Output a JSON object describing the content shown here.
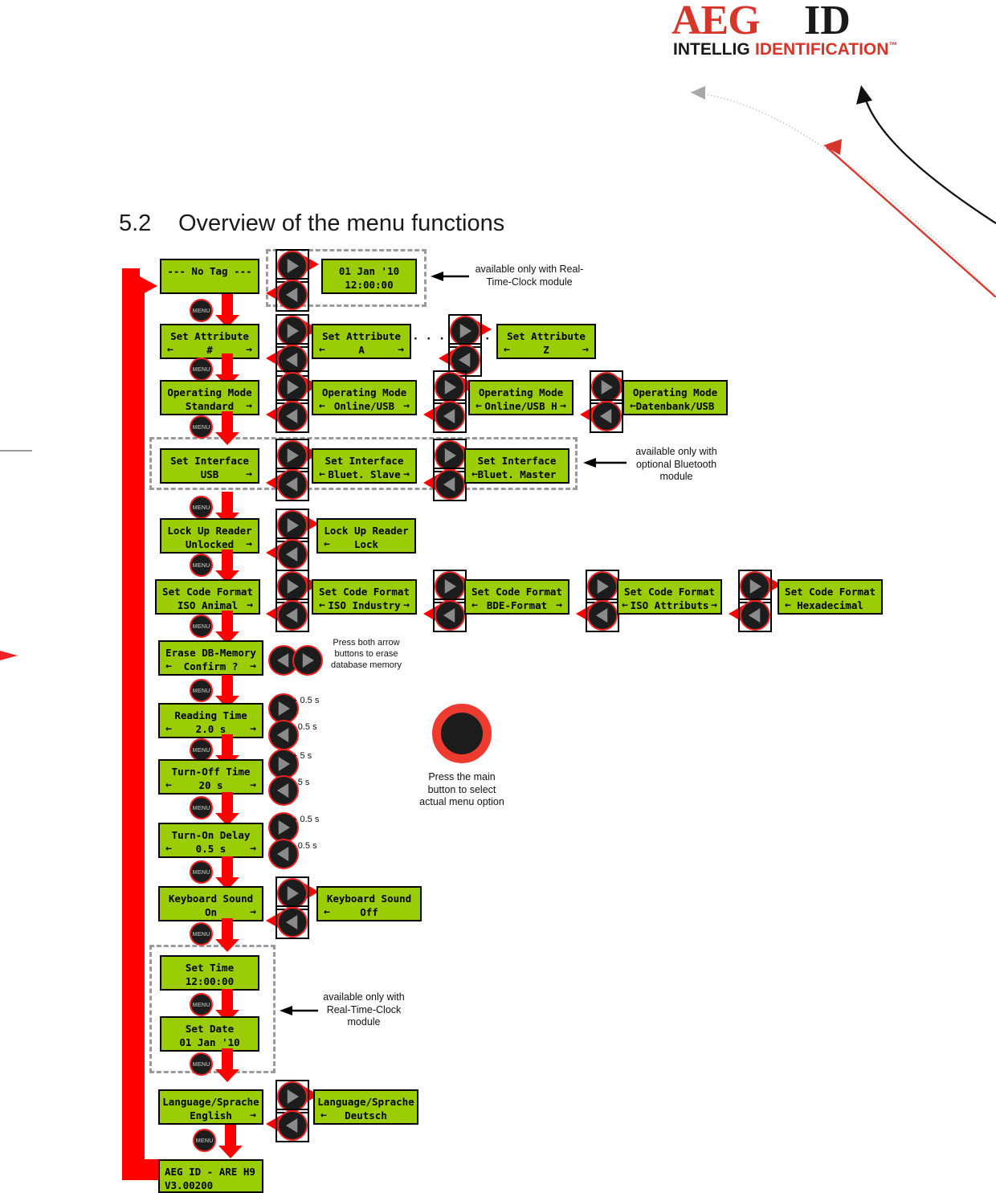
{
  "logo": {
    "brand": "AEG",
    "id": "ID",
    "tagline_left": "INTELLIG",
    "tagline_right": "IDENTIFICATION",
    "tm": "™"
  },
  "heading": {
    "number": "5.2",
    "title": "Overview of the menu functions"
  },
  "colors": {
    "lcd_green": "#9ACD05",
    "flow_red": "#FF0000",
    "button_red": "#EE2222",
    "brand_red": "#D8352A",
    "dash_gray": "#9A9A9A",
    "black": "#000000"
  },
  "labels": {
    "menu": "MENU",
    "plus_half": "+ 0.5 s",
    "minus_half": "- 0.5 s",
    "plus_five": "+ 5 s",
    "minus_five": "- 5 s",
    "ellipsis": "· · ·"
  },
  "captions": {
    "rtc_top": "available only with Real-Time-Clock module",
    "bluetooth": "available only with optional Bluetooth module",
    "erase": "Press both arrow buttons to erase database memory",
    "mainbutton": "Press the main button to select actual menu option",
    "rtc_bottom": "available only with Real-Time-Clock module"
  },
  "rows": [
    {
      "id": "idle",
      "screens": [
        {
          "l1": "--- No Tag ---",
          "l2": "",
          "left_arrow": false,
          "right_arrow": false
        },
        {
          "l1": "01 Jan '10",
          "l2": "12:00:00",
          "left_arrow": false,
          "right_arrow": false
        }
      ]
    },
    {
      "id": "set-attribute",
      "screens": [
        {
          "l1": "Set Attribute",
          "l2": "#",
          "left_arrow": true,
          "right_arrow": true
        },
        {
          "l1": "Set Attribute",
          "l2": "A",
          "left_arrow": true,
          "right_arrow": true
        },
        {
          "l1": "Set Attribute",
          "l2": "Z",
          "left_arrow": true,
          "right_arrow": true
        }
      ]
    },
    {
      "id": "operating-mode",
      "screens": [
        {
          "l1": "Operating Mode",
          "l2": "Standard",
          "left_arrow": false,
          "right_arrow": true
        },
        {
          "l1": "Operating Mode",
          "l2": "Online/USB",
          "left_arrow": true,
          "right_arrow": true
        },
        {
          "l1": "Operating Mode",
          "l2": "Online/USB H",
          "left_arrow": true,
          "right_arrow": true
        },
        {
          "l1": "Operating Mode",
          "l2": "Datenbank/USB",
          "left_arrow": true,
          "right_arrow": false
        }
      ]
    },
    {
      "id": "set-interface",
      "screens": [
        {
          "l1": "Set Interface",
          "l2": "USB",
          "left_arrow": false,
          "right_arrow": true
        },
        {
          "l1": "Set Interface",
          "l2": "Bluet. Slave",
          "left_arrow": true,
          "right_arrow": true
        },
        {
          "l1": "Set Interface",
          "l2": "Bluet. Master",
          "left_arrow": true,
          "right_arrow": false
        }
      ]
    },
    {
      "id": "lock-up-reader",
      "screens": [
        {
          "l1": "Lock Up Reader",
          "l2": "Unlocked",
          "left_arrow": false,
          "right_arrow": true
        },
        {
          "l1": "Lock Up Reader",
          "l2": "Lock",
          "left_arrow": true,
          "right_arrow": false
        }
      ]
    },
    {
      "id": "set-code-format",
      "screens": [
        {
          "l1": "Set Code Format",
          "l2": "ISO Animal",
          "left_arrow": false,
          "right_arrow": true
        },
        {
          "l1": "Set Code Format",
          "l2": "ISO Industry",
          "left_arrow": true,
          "right_arrow": true
        },
        {
          "l1": "Set Code Format",
          "l2": "BDE-Format",
          "left_arrow": true,
          "right_arrow": true
        },
        {
          "l1": "Set Code Format",
          "l2": "ISO Attributs",
          "left_arrow": true,
          "right_arrow": true
        },
        {
          "l1": "Set Code Format",
          "l2": "Hexadecimal",
          "left_arrow": true,
          "right_arrow": false
        }
      ]
    },
    {
      "id": "erase-db-memory",
      "screens": [
        {
          "l1": "Erase DB-Memory",
          "l2": "Confirm ?",
          "left_arrow": true,
          "right_arrow": true
        }
      ]
    },
    {
      "id": "reading-time",
      "screens": [
        {
          "l1": "Reading Time",
          "l2": "2.0 s",
          "left_arrow": true,
          "right_arrow": true
        }
      ]
    },
    {
      "id": "turn-off-time",
      "screens": [
        {
          "l1": "Turn-Off Time",
          "l2": "20 s",
          "left_arrow": true,
          "right_arrow": true
        }
      ]
    },
    {
      "id": "turn-on-delay",
      "screens": [
        {
          "l1": "Turn-On Delay",
          "l2": "0.5 s",
          "left_arrow": true,
          "right_arrow": true
        }
      ]
    },
    {
      "id": "keyboard-sound",
      "screens": [
        {
          "l1": "Keyboard Sound",
          "l2": "On",
          "left_arrow": false,
          "right_arrow": true
        },
        {
          "l1": "Keyboard Sound",
          "l2": "Off",
          "left_arrow": true,
          "right_arrow": false
        }
      ]
    },
    {
      "id": "set-time",
      "screens": [
        {
          "l1": "Set Time",
          "l2": "12:00:00",
          "left_arrow": false,
          "right_arrow": false
        }
      ]
    },
    {
      "id": "set-date",
      "screens": [
        {
          "l1": "Set Date",
          "l2": "01 Jan '10",
          "left_arrow": false,
          "right_arrow": false
        }
      ]
    },
    {
      "id": "language",
      "screens": [
        {
          "l1": "Language/Sprache",
          "l2": "English",
          "left_arrow": false,
          "right_arrow": true
        },
        {
          "l1": "Language/Sprache",
          "l2": "Deutsch",
          "left_arrow": true,
          "right_arrow": false
        }
      ]
    },
    {
      "id": "version",
      "screens": [
        {
          "l1": "AEG ID - ARE H9",
          "l2": "V3.00200",
          "left_arrow": false,
          "right_arrow": false,
          "align": "left"
        }
      ]
    }
  ]
}
